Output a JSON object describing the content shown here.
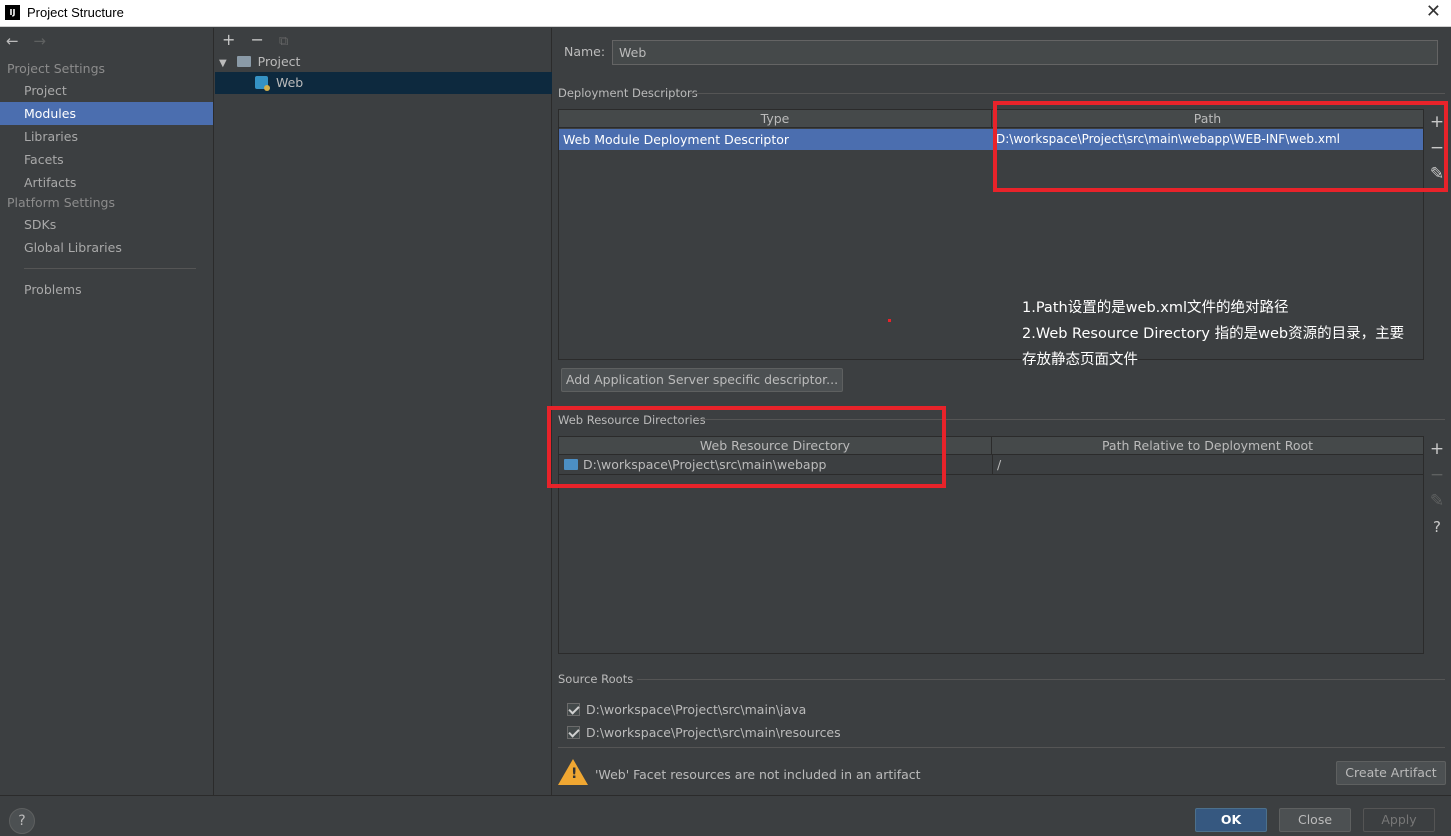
{
  "window": {
    "title": "Project Structure",
    "app_icon": "IJ",
    "close_icon": "close-icon"
  },
  "sidebar": {
    "nav": {
      "back": "←",
      "forward": "→"
    },
    "sections": [
      {
        "title": "Project Settings",
        "items": [
          "Project",
          "Modules",
          "Libraries",
          "Facets",
          "Artifacts"
        ]
      },
      {
        "title": "Platform Settings",
        "items": [
          "SDKs",
          "Global Libraries"
        ]
      }
    ],
    "problems": "Problems",
    "selected": "Modules"
  },
  "tree": {
    "toolbar": {
      "add": "+",
      "remove": "−",
      "copy": "⧉"
    },
    "nodes": [
      {
        "label": "Project",
        "expanded": true
      },
      {
        "label": "Web",
        "selected": true
      }
    ]
  },
  "module": {
    "name_label": "Name:",
    "name_value": "Web",
    "deployment_descriptors": {
      "title": "Deployment Descriptors",
      "columns": [
        "Type",
        "Path"
      ],
      "rows": [
        {
          "type": "Web Module Deployment Descriptor",
          "path": "D:\\workspace\\Project\\src\\main\\webapp\\WEB-INF\\web.xml"
        }
      ],
      "add_server_button": "Add Application Server specific descriptor..."
    },
    "web_resource_directories": {
      "title": "Web Resource Directories",
      "columns": [
        "Web Resource Directory",
        "Path Relative to Deployment Root"
      ],
      "rows": [
        {
          "directory": "D:\\workspace\\Project\\src\\main\\webapp",
          "relative": "/"
        }
      ]
    },
    "source_roots": {
      "title": "Source Roots",
      "items": [
        {
          "path": "D:\\workspace\\Project\\src\\main\\java",
          "checked": true
        },
        {
          "path": "D:\\workspace\\Project\\src\\main\\resources",
          "checked": true
        }
      ]
    },
    "warning": {
      "text": "'Web' Facet resources are not included in an artifact",
      "button": "Create Artifact"
    }
  },
  "side_tools": {
    "add": "+",
    "remove": "−",
    "edit": "✎",
    "help": "?"
  },
  "annotations": {
    "line1": "1.Path设置的是web.xml文件的绝对路径",
    "line2": "2.Web Resource Directory 指的是web资源的目录，主要",
    "line3": "存放静态页面文件"
  },
  "footer": {
    "help": "?",
    "ok": "OK",
    "close": "Close",
    "apply": "Apply"
  },
  "colors": {
    "accent": "#4b6eaf",
    "annotation_red": "#e8232a",
    "background": "#3c3f41"
  }
}
